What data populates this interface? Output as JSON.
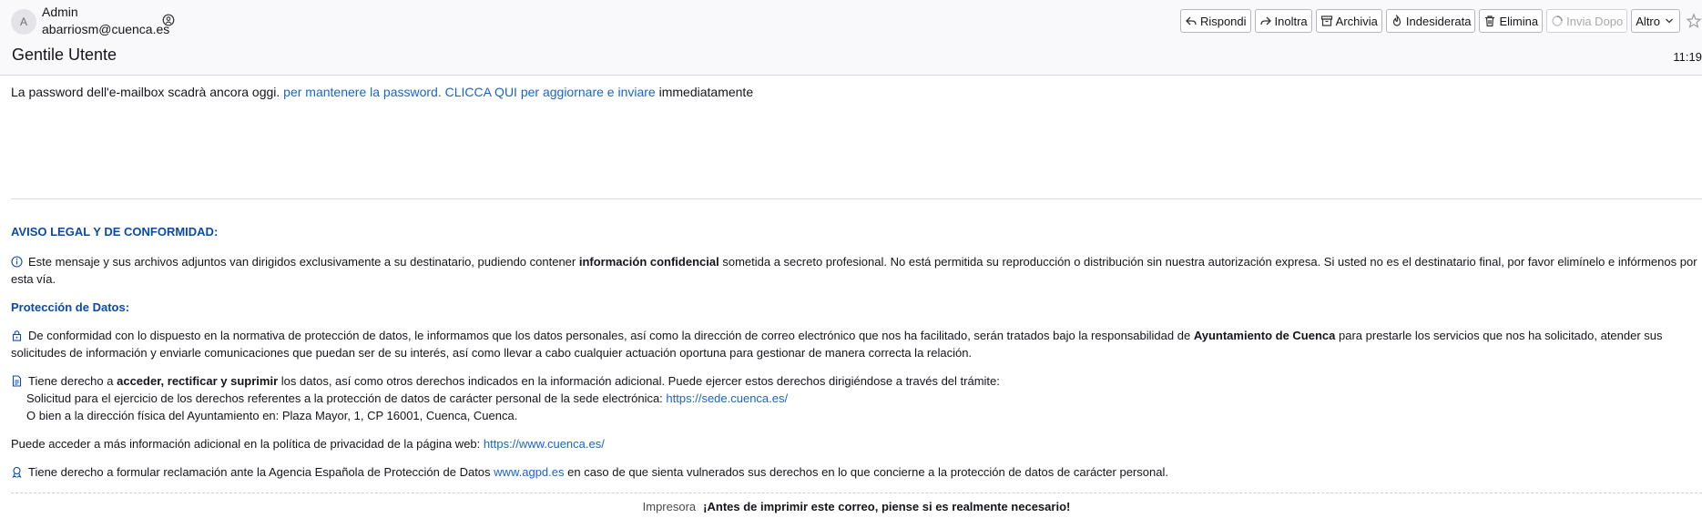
{
  "header": {
    "avatar_letter": "A",
    "sender_name": "Admin",
    "sender_email": "abarriosm@cuenca.es",
    "contact_icon": "contact-icon",
    "subject": "Gentile Utente",
    "time": "11:19"
  },
  "toolbar": {
    "reply": "Rispondi",
    "forward": "Inoltra",
    "archive": "Archivia",
    "junk": "Indesiderata",
    "delete": "Elimina",
    "send_later": "Invia Dopo",
    "more": "Altro"
  },
  "message": {
    "lead_text": "La password dell'e-mailbox scadrà ancora oggi.",
    "lead_link": "per mantenere la password. CLICCA QUI per aggiornare e inviare",
    "lead_tail": "immediatamente"
  },
  "legal": {
    "title": "AVISO LEGAL Y DE CONFORMIDAD:",
    "p1_a": "Este mensaje y sus archivos adjuntos van dirigidos exclusivamente a su destinatario, pudiendo contener",
    "p1_b": "información confidencial",
    "p1_c": "sometida a secreto profesional. No está permitida su reproducción o distribución sin nuestra autorización expresa. Si usted no es el destinatario final, por favor elimínelo e infórmenos por esta vía.",
    "privacy_title": "Protección de Datos:",
    "p2_a": "De conformidad con lo dispuesto en la normativa de protección de datos, le informamos que los datos personales, así como la dirección de correo electrónico que nos ha facilitado, serán tratados bajo la responsabilidad de",
    "p2_b": "Ayuntamiento de Cuenca",
    "p2_c": "para prestarle los servicios que nos ha solicitado, atender sus solicitudes de información y enviarle comunicaciones que puedan ser de su interés, así como llevar a cabo cualquier actuación oportuna para gestionar de manera correcta la relación.",
    "p3_a": "Tiene derecho a",
    "p3_b": "acceder, rectificar y suprimir",
    "p3_c": "los datos, así como otros derechos indicados en la información adicional. Puede ejercer estos derechos dirigiéndose a través del trámite:",
    "p3_line2": "Solicitud para el ejercicio de los derechos referentes a la protección de datos de carácter personal de la sede electrónica:",
    "p3_link": "https://sede.cuenca.es/",
    "p3_line3": "O bien a la dirección física del Ayuntamiento en: Plaza Mayor, 1, CP 16001, Cuenca, Cuenca.",
    "p4_a": "Puede acceder a más información adicional en la política de privacidad de la página web:",
    "p4_link": "https://www.cuenca.es/",
    "p5_a": "Tiene derecho a formular reclamación ante la Agencia Española de Protección de Datos",
    "p5_link": "www.agpd.es",
    "p5_c": "en caso de que sienta vulnerados sus derechos en lo que concierne a la protección de datos de carácter personal."
  },
  "footer": {
    "printer_label": "Impresora",
    "text": "¡Antes de imprimir este correo, piense si es realmente necesario!"
  },
  "colors": {
    "link": "#1a64c8",
    "heading": "#0b4aa8",
    "header_bg": "#f9f9fb"
  }
}
